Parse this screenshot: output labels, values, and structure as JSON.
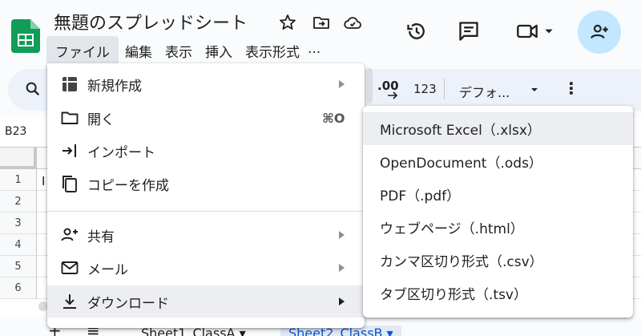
{
  "header": {
    "doc_title": "無題のスプレッドシート",
    "menus": [
      "ファイル",
      "編集",
      "表示",
      "挿入",
      "表示形式",
      "..."
    ]
  },
  "toolbar": {
    "decimal_label": ".00",
    "format_label": "123",
    "font_label": "デフォ...",
    "more_label": "⋮"
  },
  "name_box": {
    "value": "B23"
  },
  "grid": {
    "rows": [
      "1",
      "2",
      "3",
      "4",
      "5",
      "6"
    ],
    "cell_b1": "I"
  },
  "sheet_tabs": {
    "add": "+",
    "list": "≡",
    "tabs": [
      "Sheet1_ClassA ▾",
      "Sheet2_ClassB ▾"
    ]
  },
  "file_menu": {
    "items": [
      {
        "label": "新規作成",
        "icon": "sheets-new-icon",
        "has_submenu": true
      },
      {
        "label": "開く",
        "icon": "folder-icon",
        "shortcut": "⌘O"
      },
      {
        "label": "インポート",
        "icon": "import-icon"
      },
      {
        "label": "コピーを作成",
        "icon": "copy-icon"
      },
      {
        "label": "共有",
        "icon": "share-person-icon",
        "has_submenu": true
      },
      {
        "label": "メール",
        "icon": "mail-icon",
        "has_submenu": true
      },
      {
        "label": "ダウンロード",
        "icon": "download-icon",
        "has_submenu": true,
        "highlighted": true
      }
    ]
  },
  "download_submenu": {
    "items": [
      {
        "label": "Microsoft Excel（.xlsx）",
        "highlighted": true
      },
      {
        "label": "OpenDocument（.ods）"
      },
      {
        "label": "PDF（.pdf）"
      },
      {
        "label": "ウェブページ（.html）"
      },
      {
        "label": "カンマ区切り形式（.csv）"
      },
      {
        "label": "タブ区切り形式（.tsv）"
      }
    ]
  },
  "colors": {
    "brand_green": "#0f9d58",
    "share_button_bg": "#c2e7ff",
    "active_tab_text": "#0b57d0",
    "toolbar_bg": "#edf2fa"
  }
}
